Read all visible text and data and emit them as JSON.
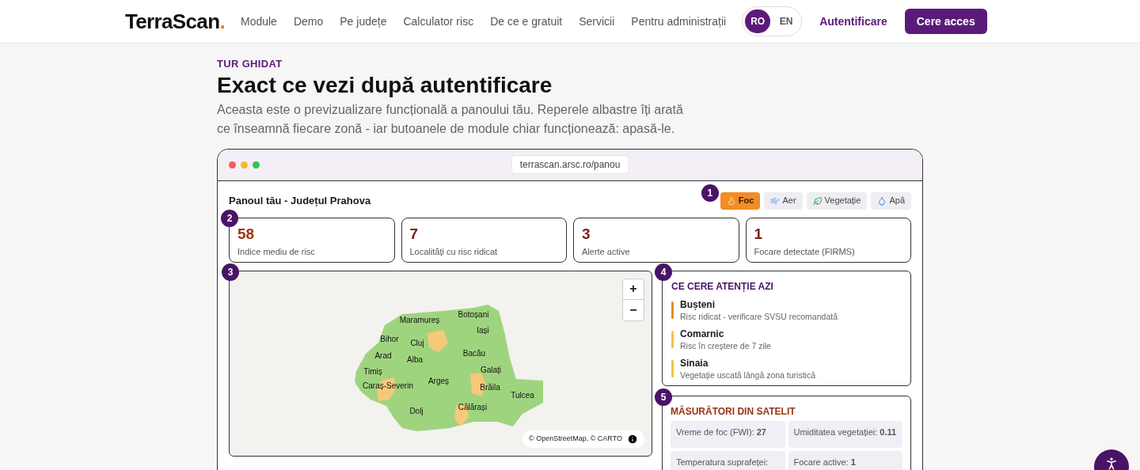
{
  "header": {
    "logo": {
      "text": "TerraScan",
      "dot": "."
    },
    "nav": [
      "Module",
      "Demo",
      "Pe județe",
      "Calculator risc",
      "De ce e gratuit",
      "Servicii",
      "Pentru administrații"
    ],
    "languages": [
      {
        "label": "RO",
        "selected": true
      },
      {
        "label": "EN",
        "selected": false
      }
    ],
    "login": "Autentificare",
    "cta": "Cere acces"
  },
  "intro": {
    "eyebrow": "TUR GHIDAT",
    "title": "Exact ce vezi după autentificare",
    "text": "Aceasta este o previzualizare funcțională a panoului tău. Reperele albastre îți arată ce înseamnă fiecare zonă - iar butoanele de module chiar funcționează: apasă-le."
  },
  "browser": {
    "url": "terrascan.arsc.ro/panou"
  },
  "dashboard": {
    "title": "Panoul tău - Județul Prahova",
    "markers": [
      "1",
      "2",
      "3",
      "4",
      "5"
    ],
    "modules": [
      {
        "kind": "fire",
        "label": "Foc",
        "selected": true
      },
      {
        "kind": "air",
        "label": "Aer",
        "selected": false
      },
      {
        "kind": "vegetation",
        "label": "Vegetație",
        "selected": false
      },
      {
        "kind": "water",
        "label": "Apă",
        "selected": false
      }
    ],
    "stats": [
      {
        "value": "58",
        "label": "Indice mediu de risc",
        "color": "#9a3412"
      },
      {
        "value": "7",
        "label": "Localități cu risc ridicat",
        "color": "#7f1d1d"
      },
      {
        "value": "3",
        "label": "Alerte active",
        "color": "#7f1d1d"
      },
      {
        "value": "1",
        "label": "Focare detectate (FIRMS)",
        "color": "#7f1d1d"
      }
    ],
    "map": {
      "zoom_in": "+",
      "zoom_out": "−",
      "attribution": "© OpenStreetMap, © CARTO",
      "labels": [
        "Maramureș",
        "Botoșani",
        "Iași",
        "Bihor",
        "Cluj",
        "Bacău",
        "Arad",
        "Alba",
        "Galați",
        "Timiș",
        "Argeș",
        "Caraș-Severin",
        "Brăila",
        "Tulcea",
        "Dolj",
        "Călărași"
      ]
    },
    "attention": {
      "title": "CE CERE ATENȚIE AZI",
      "items": [
        {
          "name": "Bușteni",
          "note": "Risc ridicat - verificare SVSU recomandată",
          "color": "#e8892b"
        },
        {
          "name": "Comarnic",
          "note": "Risc în creștere de 7 zile",
          "color": "#f2c443"
        },
        {
          "name": "Sinaia",
          "note": "Vegetație uscată lângă zona turistică",
          "color": "#f2c443"
        }
      ]
    },
    "satellite": {
      "title": "MĂSURĂTORI DIN SATELIT",
      "items": [
        "Vreme de foc (FWI): **27**",
        "Umiditatea vegetației: **0.11**",
        "Temperatura suprafeței:",
        "Focare active: **1**"
      ]
    }
  }
}
